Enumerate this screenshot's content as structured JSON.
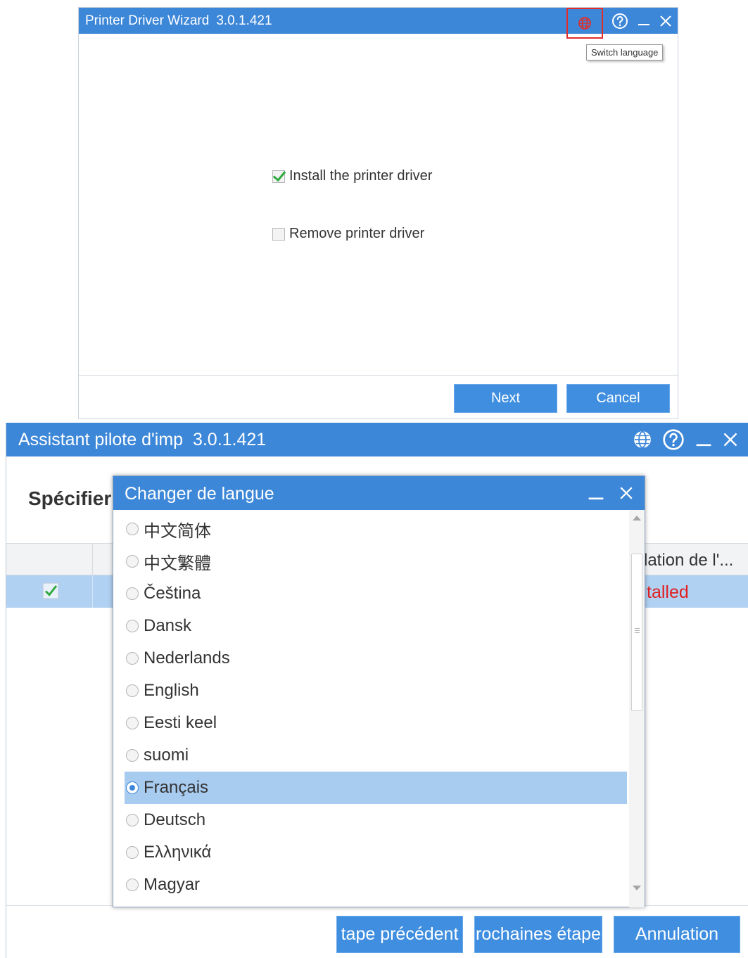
{
  "window1": {
    "title": "Printer Driver Wizard",
    "version": "3.0.1.421",
    "tooltip": "Switch language",
    "options": [
      {
        "label": "Install the printer driver",
        "checked": true
      },
      {
        "label": "Remove printer driver",
        "checked": false
      }
    ],
    "buttons": {
      "next": "Next",
      "cancel": "Cancel"
    }
  },
  "window2": {
    "title": "Assistant pilote d'imp",
    "version": "3.0.1.421",
    "heading": "Spécifier",
    "table": {
      "header_visible": "lation de l'...",
      "row_status_visible": "talled",
      "row_checked": true
    },
    "buttons": {
      "previous": "tape précédent",
      "next": "rochaines étape",
      "cancel": "Annulation"
    }
  },
  "dialog": {
    "title": "Changer de langue",
    "languages": [
      {
        "label": "中文简体",
        "selected": false
      },
      {
        "label": "中文繁體",
        "selected": false
      },
      {
        "label": "Čeština",
        "selected": false
      },
      {
        "label": "Dansk",
        "selected": false
      },
      {
        "label": "Nederlands",
        "selected": false
      },
      {
        "label": "English",
        "selected": false
      },
      {
        "label": "Eesti keel",
        "selected": false
      },
      {
        "label": "suomi",
        "selected": false
      },
      {
        "label": "Français",
        "selected": true
      },
      {
        "label": "Deutsch",
        "selected": false
      },
      {
        "label": "Ελληνικά",
        "selected": false
      },
      {
        "label": "Magyar",
        "selected": false
      }
    ]
  },
  "colors": {
    "titlebar": "#3d87d8",
    "button": "#3f8ee0",
    "selection": "#a8cbf0",
    "row_selection": "#b1d1f3",
    "status_red": "#e02020",
    "highlight_box": "#e12c2c",
    "check_green": "#2faa3f"
  },
  "icons": [
    "globe-icon",
    "help-icon",
    "minimize-icon",
    "close-icon",
    "checkmark-icon"
  ]
}
